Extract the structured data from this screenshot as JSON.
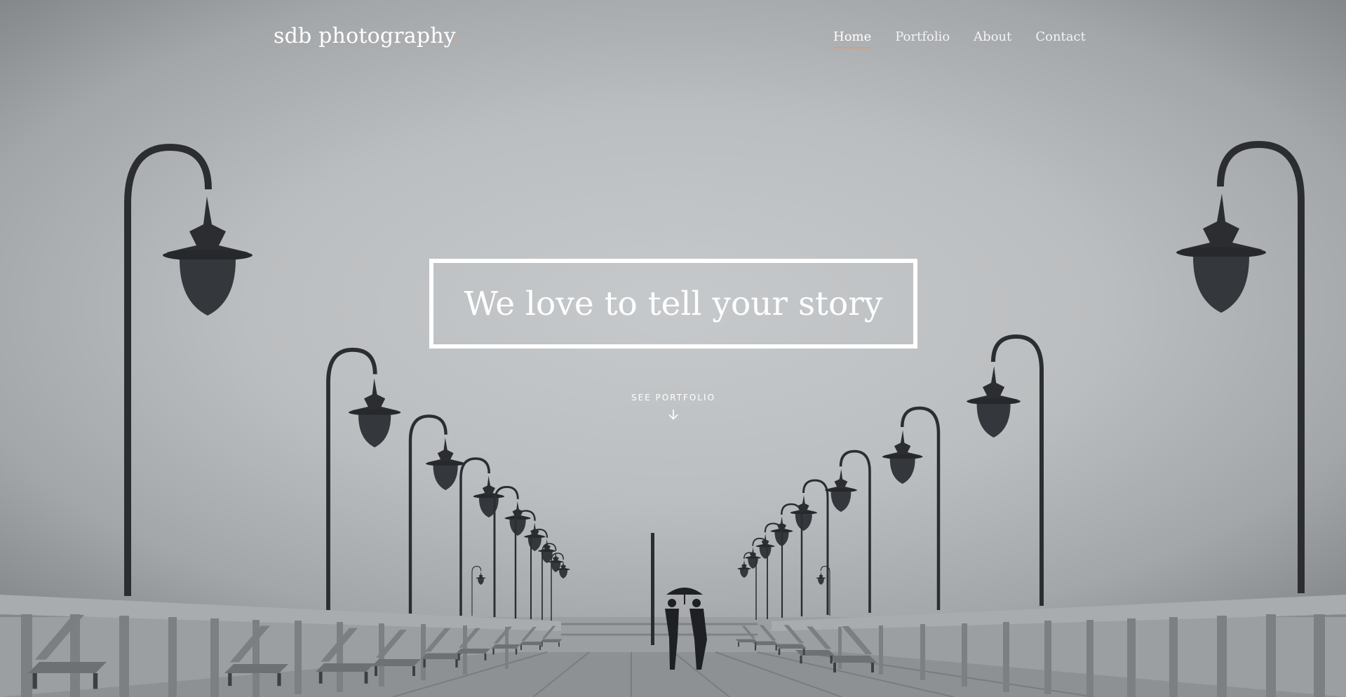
{
  "brand": {
    "name": "sdb photography",
    "dot": "."
  },
  "nav": {
    "items": [
      {
        "label": "Home",
        "active": true
      },
      {
        "label": "Portfolio",
        "active": false
      },
      {
        "label": "About",
        "active": false
      },
      {
        "label": "Contact",
        "active": false
      }
    ]
  },
  "hero": {
    "headline": "We love to tell your story",
    "cta_label": "SEE PORTFOLIO",
    "cta_icon": "arrow-down-icon",
    "image_subject": "couple-under-umbrella-on-pier"
  },
  "colors": {
    "accent": "#e09a72",
    "text": "#ffffff",
    "lamp": "#2b2d31"
  }
}
